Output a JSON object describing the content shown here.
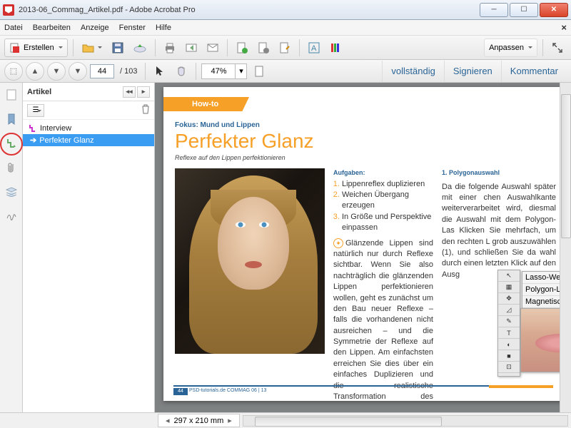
{
  "window": {
    "title": "2013-06_Commag_Artikel.pdf - Adobe Acrobat Pro"
  },
  "menu": {
    "file": "Datei",
    "edit": "Bearbeiten",
    "view": "Anzeige",
    "window": "Fenster",
    "help": "Hilfe"
  },
  "toolbar": {
    "create": "Erstellen",
    "customize": "Anpassen"
  },
  "nav": {
    "page_current": "44",
    "page_total": "/  103",
    "zoom": "47%",
    "link_full": "vollständig",
    "link_sign": "Signieren",
    "link_comment": "Kommentar"
  },
  "panel": {
    "title": "Artikel",
    "items": [
      {
        "label": "Interview",
        "selected": false
      },
      {
        "label": "Perfekter Glanz",
        "selected": true
      }
    ]
  },
  "doc": {
    "tab": "How-to",
    "fokus": "Fokus: Mund und Lippen",
    "h1": "Perfekter Glanz",
    "sub": "Reflexe auf den Lippen perfektionieren",
    "aufgaben_h": "Aufgaben:",
    "aufgaben": [
      "Lippenreflex duplizieren",
      "Weichen Übergang erzeugen",
      "In Größe und Perspektive einpassen"
    ],
    "para1": "Glänzende Lippen sind natürlich nur durch Reflexe sichtbar. Wenn Sie also nachträglich die glänzenden Lippen perfektionieren wollen, geht es zunächst um den Bau neuer Reflexe – falls die vorhandenen nicht ausreichen – und die Symmetrie der Reflexe auf den Lippen. Am einfachsten erreichen Sie dies über ein einfaches Duplizieren und die realistische Transformation des vorhandenen Reflexes.",
    "poly_h": "1. Polygonauswahl",
    "poly_p": "Da die folgende Auswahl später mit einer chen Auswahlkante weiterverarbeitet wird, diesmal die Auswahl mit dem Polygon-Las Klicken Sie mehrfach, um den rechten L grob auszuwählen (1), und schließen Sie da wahl durch einen letzten Klick auf den Ausg",
    "fly1": "Lasso-Werkzeug",
    "fly2": "Polygon-Lasso-Werkzeug",
    "fly3": "Magnetisches-Lasso-Werkzeug",
    "pgnum": "44",
    "pgref": "PSD-tutorials.de   COMMAG 06 | 13"
  },
  "status": {
    "dims": "297 x 210 mm"
  }
}
